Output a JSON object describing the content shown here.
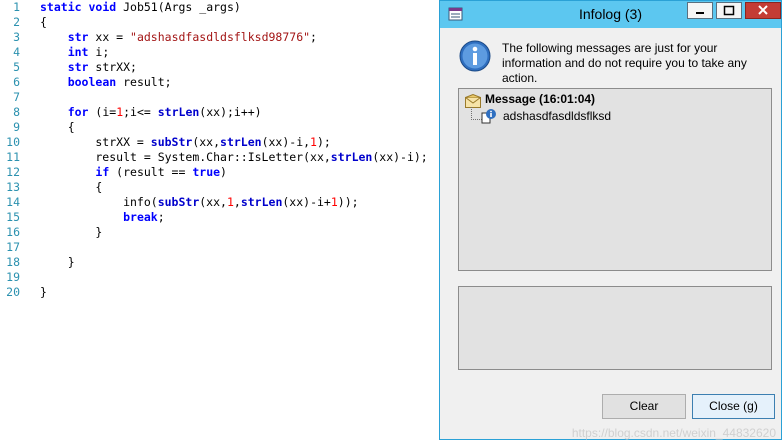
{
  "editor": {
    "lines": [
      {
        "n": "1",
        "text": "static void Job51(Args _args)"
      },
      {
        "n": "2",
        "text": "{"
      },
      {
        "n": "3",
        "text": "    str xx = \"adshasdfasdldsflksd98776\";"
      },
      {
        "n": "4",
        "text": "    int i;"
      },
      {
        "n": "5",
        "text": "    str strXX;"
      },
      {
        "n": "6",
        "text": "    boolean result;"
      },
      {
        "n": "7",
        "text": ""
      },
      {
        "n": "8",
        "text": "    for (i=1;i<= strLen(xx);i++)"
      },
      {
        "n": "9",
        "text": "    {"
      },
      {
        "n": "10",
        "text": "        strXX = subStr(xx,strLen(xx)-i,1);"
      },
      {
        "n": "11",
        "text": "        result = System.Char::IsLetter(xx,strLen(xx)-i);"
      },
      {
        "n": "12",
        "text": "        if (result == true)"
      },
      {
        "n": "13",
        "text": "        {"
      },
      {
        "n": "14",
        "text": "            info(subStr(xx,1,strLen(xx)-i+1));"
      },
      {
        "n": "15",
        "text": "            break;"
      },
      {
        "n": "16",
        "text": "        }"
      },
      {
        "n": "17",
        "text": ""
      },
      {
        "n": "18",
        "text": "    }"
      },
      {
        "n": "19",
        "text": ""
      },
      {
        "n": "20",
        "text": "}"
      }
    ]
  },
  "dialog": {
    "title": "Infolog (3)",
    "info_text": "The following messages are just for your information and do not require you to take any action.",
    "tree": {
      "node_label": "Message (16:01:04)",
      "child_label": "adshasdfasdldsflksd"
    },
    "buttons": {
      "clear": "Clear",
      "close": "Close (g)"
    }
  },
  "watermark": "https://blog.csdn.net/weixin_44832620",
  "colors": {
    "titlebar": "#5cc7f0",
    "keyword": "#0000ff",
    "string": "#a31515",
    "line_number": "#2b91af"
  }
}
